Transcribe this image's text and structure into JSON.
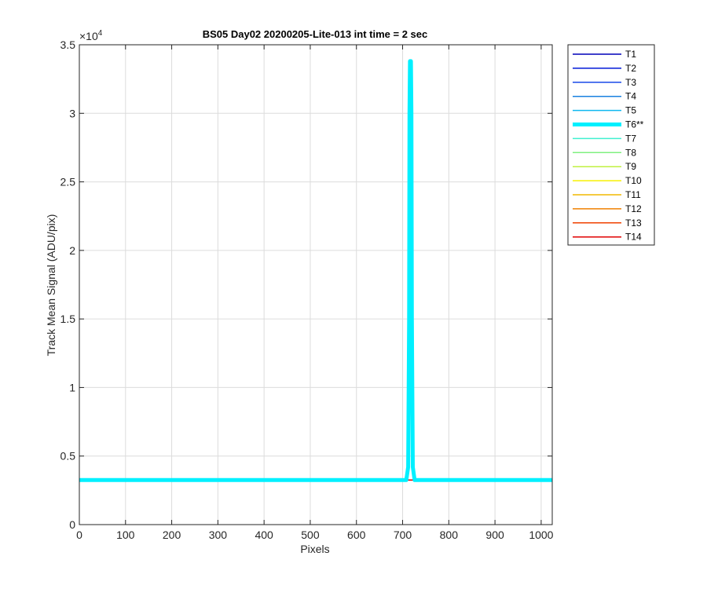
{
  "chart_data": {
    "type": "line",
    "title": "BS05 Day02 20200205-Lite-013 int time = 2 sec",
    "xlabel": "Pixels",
    "ylabel": "Track Mean Signal (ADU/pix)",
    "xlim": [
      0,
      1024
    ],
    "ylim": [
      0,
      35000
    ],
    "xticks": [
      0,
      100,
      200,
      300,
      400,
      500,
      600,
      700,
      800,
      900,
      1000
    ],
    "yticks": [
      0,
      5000,
      10000,
      15000,
      20000,
      25000,
      30000,
      35000
    ],
    "ytick_labels": [
      "0",
      "0.5",
      "1",
      "1.5",
      "2",
      "2.5",
      "3",
      "3.5"
    ],
    "y_exponent_label": "×10",
    "y_exponent_power": "4",
    "grid": true,
    "legend_position": "outside-top-right",
    "baseline_value": 3250,
    "series": [
      {
        "name": "T1",
        "color": "#0000b8",
        "width": 1.5,
        "points": [
          [
            0,
            3250
          ],
          [
            1024,
            3250
          ]
        ]
      },
      {
        "name": "T2",
        "color": "#0018d8",
        "width": 1.5,
        "points": [
          [
            0,
            3250
          ],
          [
            1024,
            3250
          ]
        ]
      },
      {
        "name": "T3",
        "color": "#1848e8",
        "width": 1.5,
        "points": [
          [
            0,
            3250
          ],
          [
            1024,
            3250
          ]
        ]
      },
      {
        "name": "T4",
        "color": "#1880e0",
        "width": 1.5,
        "points": [
          [
            0,
            3250
          ],
          [
            1024,
            3250
          ]
        ]
      },
      {
        "name": "T5",
        "color": "#10b8f0",
        "width": 1.5,
        "points": [
          [
            0,
            3250
          ],
          [
            1024,
            3250
          ]
        ]
      },
      {
        "name": "T6**",
        "color": "#00f0ff",
        "width": 5,
        "points": [
          [
            0,
            3250
          ],
          [
            708,
            3250
          ],
          [
            712,
            4200
          ],
          [
            714,
            15000
          ],
          [
            715,
            30000
          ],
          [
            716,
            33800
          ],
          [
            718,
            33800
          ],
          [
            719,
            30000
          ],
          [
            720,
            15000
          ],
          [
            722,
            4200
          ],
          [
            726,
            3250
          ],
          [
            1024,
            3250
          ]
        ]
      },
      {
        "name": "T7",
        "color": "#40f0d0",
        "width": 1.5,
        "points": [
          [
            0,
            3250
          ],
          [
            1024,
            3250
          ]
        ]
      },
      {
        "name": "T8",
        "color": "#80f080",
        "width": 1.5,
        "points": [
          [
            0,
            3250
          ],
          [
            1024,
            3250
          ]
        ]
      },
      {
        "name": "T9",
        "color": "#c0f040",
        "width": 1.5,
        "points": [
          [
            0,
            3250
          ],
          [
            1024,
            3250
          ]
        ]
      },
      {
        "name": "T10",
        "color": "#f8f000",
        "width": 1.5,
        "points": [
          [
            0,
            3250
          ],
          [
            1024,
            3250
          ]
        ]
      },
      {
        "name": "T11",
        "color": "#f0b800",
        "width": 1.5,
        "points": [
          [
            0,
            3250
          ],
          [
            1024,
            3250
          ]
        ]
      },
      {
        "name": "T12",
        "color": "#f08000",
        "width": 1.5,
        "points": [
          [
            0,
            3250
          ],
          [
            1024,
            3250
          ]
        ]
      },
      {
        "name": "T13",
        "color": "#f04000",
        "width": 1.5,
        "points": [
          [
            0,
            3250
          ],
          [
            1024,
            3250
          ]
        ]
      },
      {
        "name": "T14",
        "color": "#e00000",
        "width": 1.5,
        "points": [
          [
            0,
            3250
          ],
          [
            1024,
            3250
          ]
        ]
      }
    ]
  }
}
